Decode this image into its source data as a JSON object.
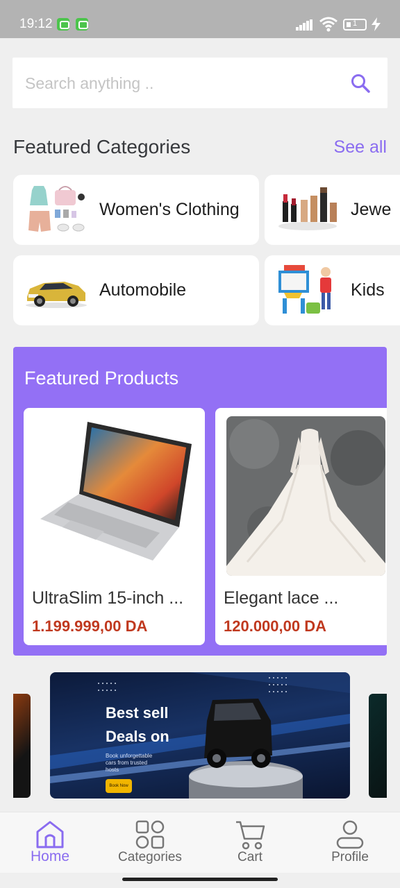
{
  "status_bar": {
    "time": "19:12",
    "battery": "1"
  },
  "search": {
    "placeholder": "Search anything ..",
    "icon": "search-icon"
  },
  "featured_categories": {
    "title": "Featured Categories",
    "see_all": "See all",
    "items": [
      {
        "label": "Women's Clothing"
      },
      {
        "label": "Jewe"
      },
      {
        "label": "Automobile"
      },
      {
        "label": "Kids"
      }
    ]
  },
  "featured_products": {
    "title": "Featured Products",
    "items": [
      {
        "name": "UltraSlim 15-inch ...",
        "price": "1.199.999,00 DA"
      },
      {
        "name": "Elegant lace ...",
        "price": "120.000,00 DA"
      }
    ]
  },
  "banner": {
    "line1": "Best sell",
    "line2": "Deals on",
    "sub": "Book unforgettable cars from trusted hosts",
    "button": "Book Now"
  },
  "bottom_nav": {
    "items": [
      {
        "label": "Home",
        "icon": "home-icon",
        "active": true
      },
      {
        "label": "Categories",
        "icon": "grid-icon",
        "active": false
      },
      {
        "label": "Cart",
        "icon": "cart-icon",
        "active": false
      },
      {
        "label": "Profile",
        "icon": "user-icon",
        "active": false
      }
    ]
  },
  "colors": {
    "accent": "#8a6cf0",
    "featured_bg": "#9370f5",
    "price": "#c0391f",
    "background": "#efefef"
  }
}
